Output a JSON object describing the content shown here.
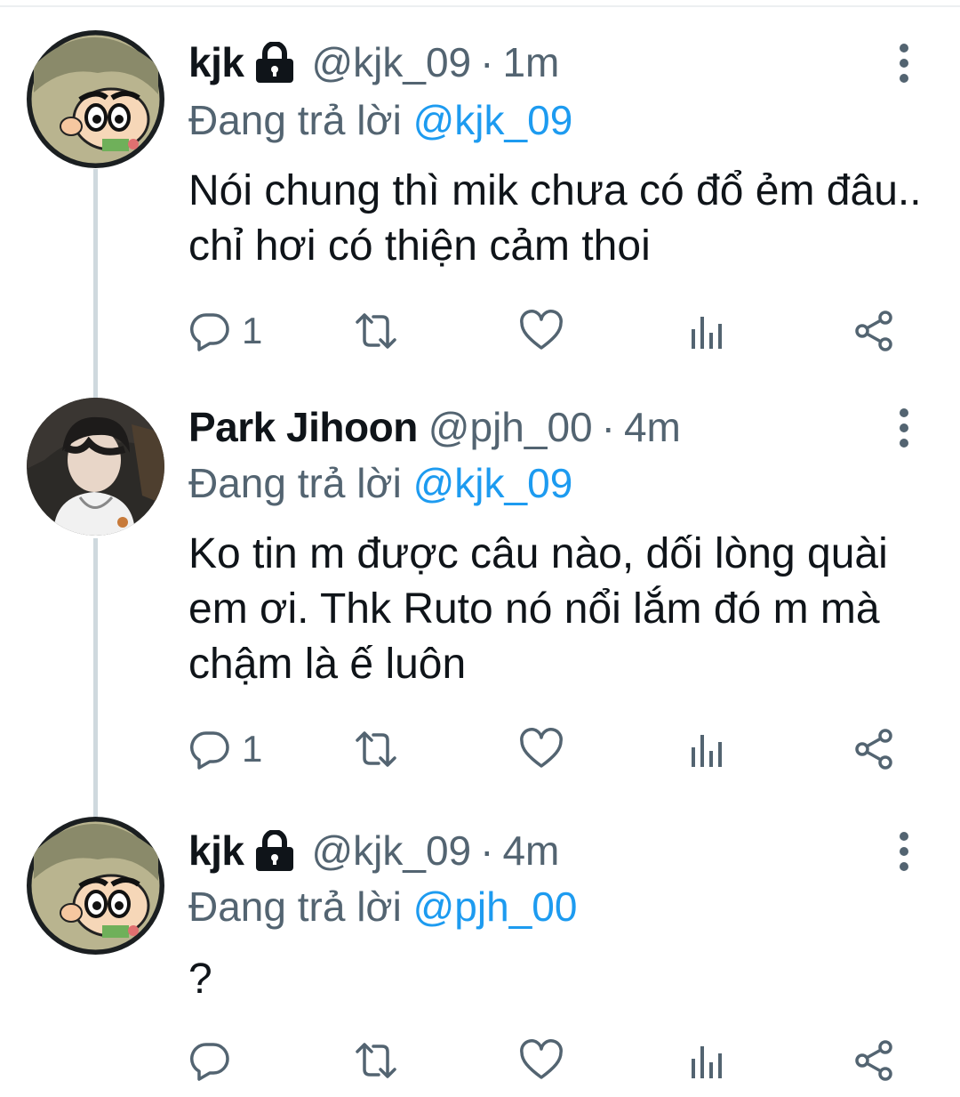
{
  "colors": {
    "text": "#0f1419",
    "muted": "#536471",
    "link": "#1d9bf0",
    "thread": "#cfd9de"
  },
  "tweets": [
    {
      "name": "kjk",
      "locked": true,
      "handle": "@kjk_09",
      "separator": "·",
      "time": "1m",
      "replying_prefix": "Đang trả lời",
      "replying_to": "@kjk_09",
      "text": "Nói chung thì mik chưa có đổ ẻm đâu.. chỉ hơi có thiện cảm thoi",
      "reply_count": "1",
      "avatar": "shinchan-avatar"
    },
    {
      "name": "Park Jihoon",
      "locked": false,
      "handle": "@pjh_00",
      "separator": "·",
      "time": "4m",
      "replying_prefix": "Đang trả lời",
      "replying_to": "@kjk_09",
      "text": "Ko tin m được câu nào, dối lòng quài em ơi. Thk Ruto nó nổi lắm đó m mà chậm là ế luôn",
      "reply_count": "1",
      "avatar": "person-photo-avatar"
    },
    {
      "name": "kjk",
      "locked": true,
      "handle": "@kjk_09",
      "separator": "·",
      "time": "4m",
      "replying_prefix": "Đang trả lời",
      "replying_to": "@pjh_00",
      "text": "?",
      "reply_count": "",
      "avatar": "shinchan-avatar"
    }
  ],
  "icons": [
    "reply-icon",
    "retweet-icon",
    "like-icon",
    "analytics-icon",
    "share-icon",
    "more-icon",
    "lock-icon"
  ]
}
